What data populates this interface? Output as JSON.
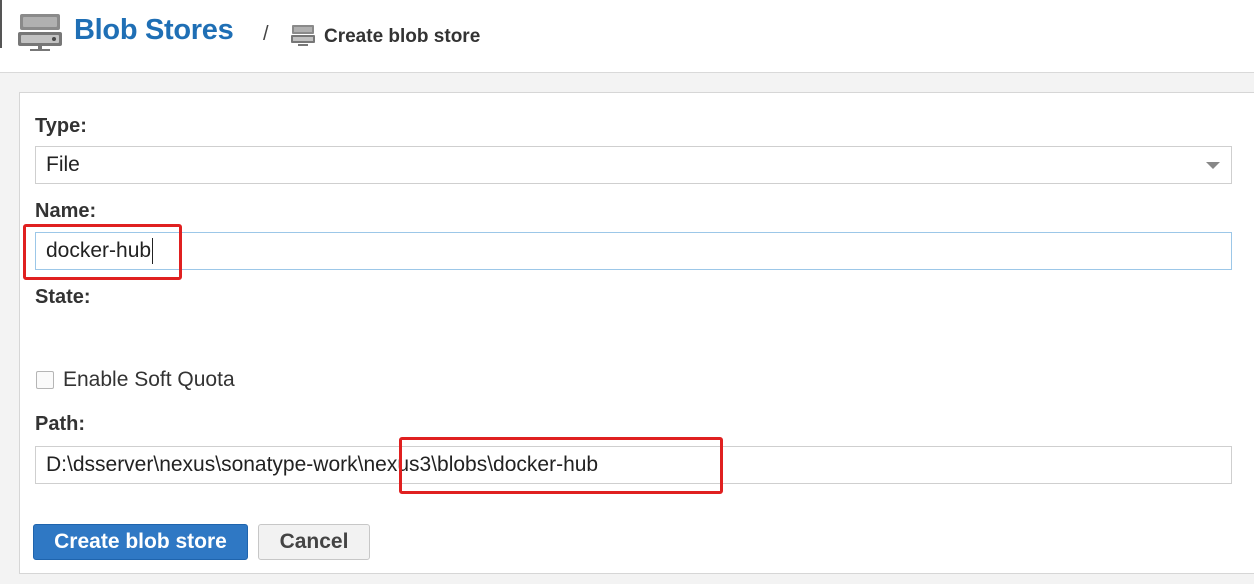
{
  "header": {
    "title": "Blob Stores",
    "separator": "/",
    "subtitle": "Create blob store",
    "icon": "server-storage-icon"
  },
  "form": {
    "type_label": "Type:",
    "type_value": "File",
    "name_label": "Name:",
    "name_value": "docker-hub",
    "state_label": "State:",
    "soft_quota_label": "Enable Soft Quota",
    "soft_quota_checked": false,
    "path_label": "Path:",
    "path_value": "D:\\dsserver\\nexus\\sonatype-work\\nexus3\\blobs\\docker-hub"
  },
  "buttons": {
    "create": "Create blob store",
    "cancel": "Cancel"
  },
  "colors": {
    "accent": "#2f78c4",
    "title": "#1f6fb5",
    "annotation": "#e02020"
  }
}
